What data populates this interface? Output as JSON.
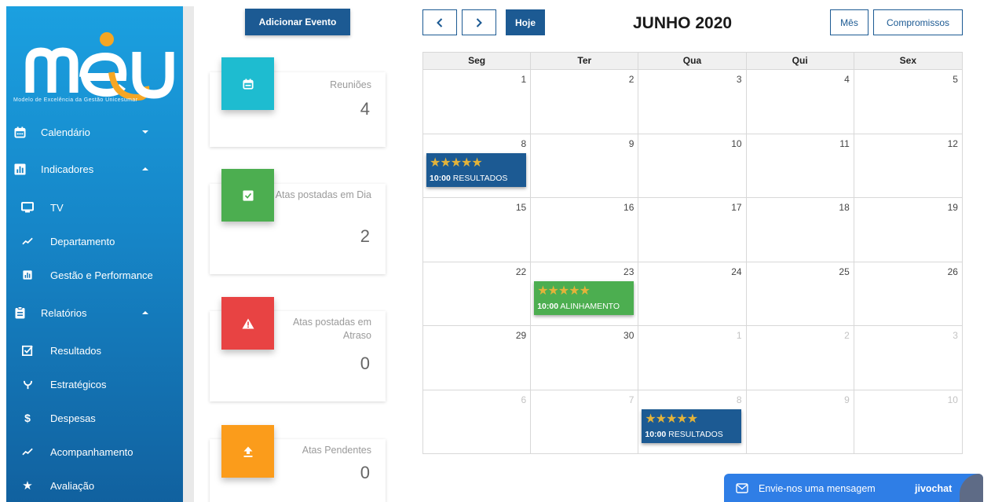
{
  "sidebar": {
    "logo_text": "meu",
    "logo_tagline": "Modelo de Excelência da Gestão Unicesumar",
    "items": [
      {
        "label": "Calendário",
        "icon": "calendar-icon"
      },
      {
        "label": "Indicadores",
        "icon": "bar-chart-icon"
      },
      {
        "label": "TV",
        "icon": "tv-icon"
      },
      {
        "label": "Departamento",
        "icon": "trending-icon"
      },
      {
        "label": "Gestão e Performance",
        "icon": "bar-chart-icon"
      },
      {
        "label": "Relatórios",
        "icon": "clipboard-icon"
      },
      {
        "label": "Resultados",
        "icon": "checkbox-icon"
      },
      {
        "label": "Estratégicos",
        "icon": "branch-icon"
      },
      {
        "label": "Despesas",
        "icon": "dollar-icon"
      },
      {
        "label": "Acompanhamento",
        "icon": "trending-icon"
      },
      {
        "label": "Avaliação",
        "icon": "star-icon"
      }
    ]
  },
  "actions": {
    "add_event": "Adicionar Evento"
  },
  "cards": [
    {
      "title": "Reuniões",
      "value": "4",
      "color": "#1ebcd0",
      "icon": "calendar-icon"
    },
    {
      "title": "Atas postadas em Dia",
      "value": "2",
      "color": "#4cae50",
      "icon": "check-icon"
    },
    {
      "title": "Atas postadas em Atraso",
      "value": "0",
      "color": "#e84343",
      "icon": "warning-icon"
    },
    {
      "title": "Atas Pendentes",
      "value": "0",
      "color": "#fb9c1b",
      "icon": "upload-icon"
    }
  ],
  "calendar": {
    "title": "JUNHO 2020",
    "today_label": "Hoje",
    "view_month": "Mês",
    "view_appointments": "Compromissos",
    "weekdays": [
      "Seg",
      "Ter",
      "Qua",
      "Qui",
      "Sex"
    ],
    "weeks": [
      [
        "1",
        "2",
        "3",
        "4",
        "5"
      ],
      [
        "8",
        "9",
        "10",
        "11",
        "12"
      ],
      [
        "15",
        "16",
        "17",
        "18",
        "19"
      ],
      [
        "22",
        "23",
        "24",
        "25",
        "26"
      ],
      [
        "29",
        "30",
        "1",
        "2",
        "3"
      ],
      [
        "6",
        "7",
        "8",
        "9",
        "10"
      ]
    ],
    "events": [
      {
        "stars": "★★★★★",
        "time": "10:00",
        "label": "RESULTADOS",
        "color": "#1c5a93"
      },
      {
        "stars": "★★★★★",
        "time": "10:00",
        "label": "ALINHAMENTO",
        "color": "#4cae50"
      },
      {
        "stars": "★★★★★",
        "time": "10:00",
        "label": "RESULTADOS",
        "color": "#1c5a93"
      }
    ]
  },
  "chat": {
    "label": "Envie-nos uma mensagem",
    "brand": "jivochat"
  }
}
